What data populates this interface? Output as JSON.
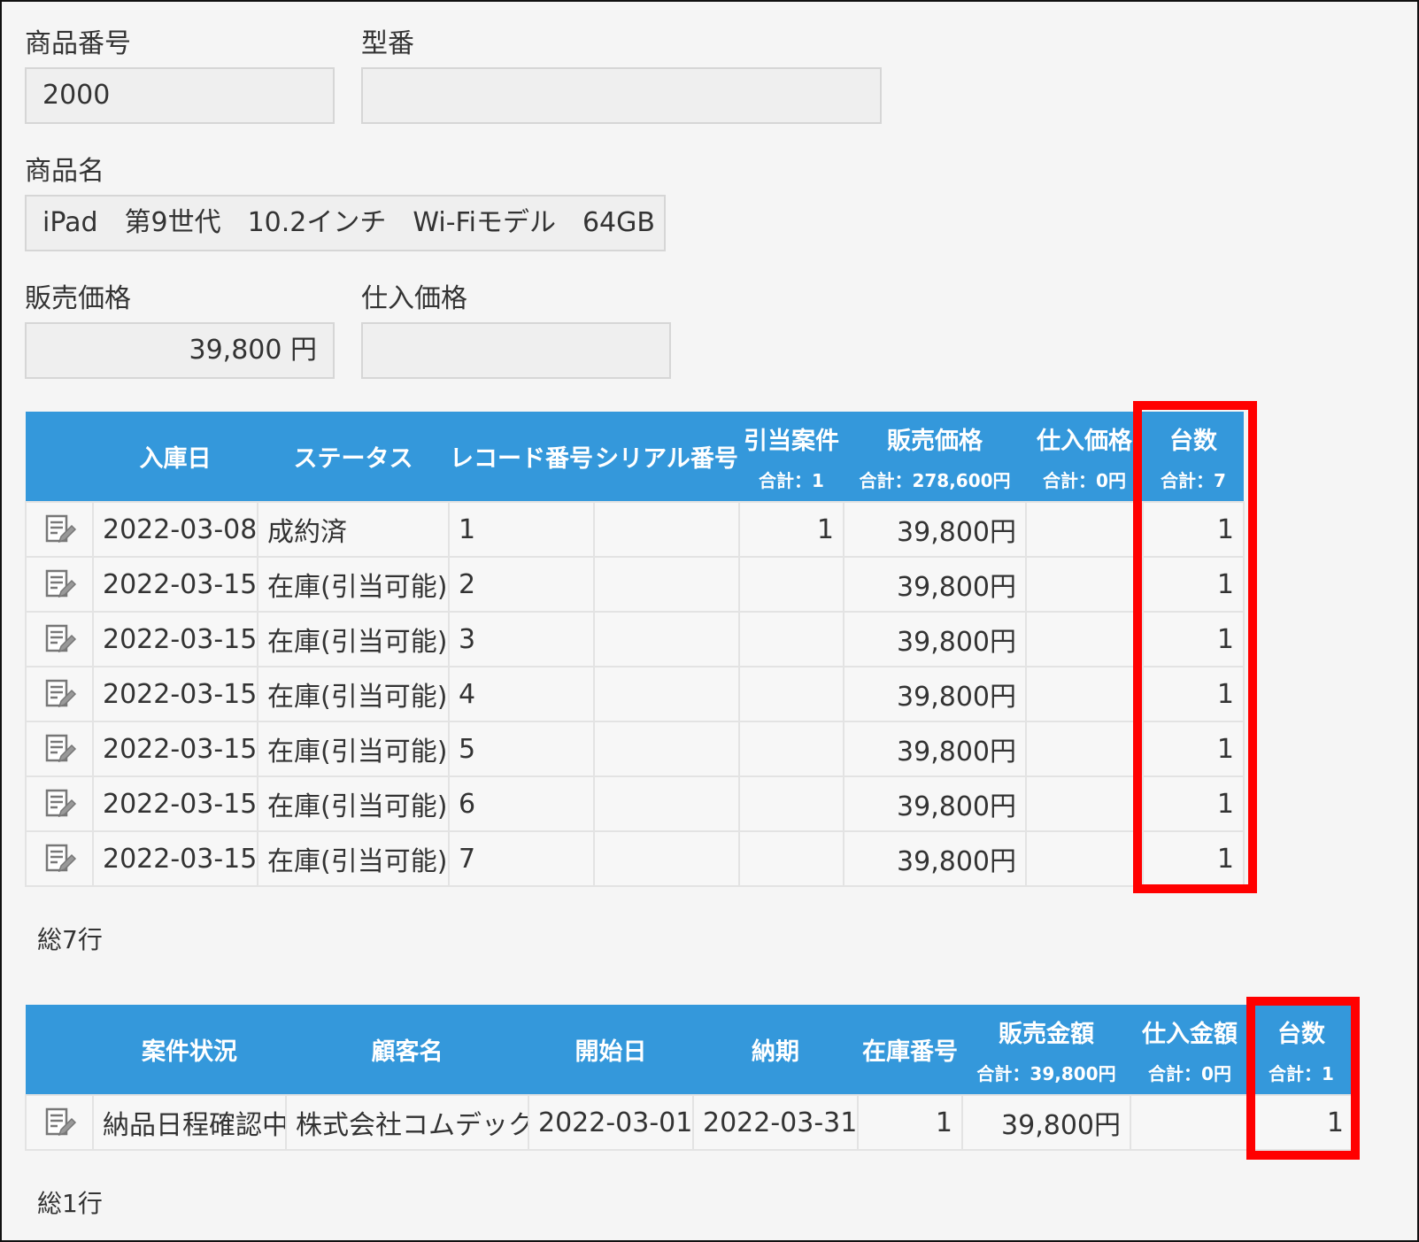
{
  "form": {
    "product_number_label": "商品番号",
    "product_number_value": "2000",
    "model_label": "型番",
    "model_value": "",
    "product_name_label": "商品名",
    "product_name_value": "iPad　第9世代　10.2インチ　Wi-Fiモデル　64GB",
    "sale_price_label": "販売価格",
    "sale_price_value": "39,800 円",
    "purchase_price_label": "仕入価格",
    "purchase_price_value": ""
  },
  "stock_table": {
    "headers": {
      "date": "入庫日",
      "status": "ステータス",
      "record_no": "レコード番号",
      "serial_no": "シリアル番号",
      "allocated": "引当案件",
      "allocated_total": "合計：1",
      "sale_price": "販売価格",
      "sale_price_total": "合計：278,600円",
      "purchase_price": "仕入価格",
      "purchase_price_total": "合計：0円",
      "units": "台数",
      "units_total": "合計：7"
    },
    "rows": [
      {
        "date": "2022-03-08",
        "status": "成約済",
        "record_no": "1",
        "serial_no": "",
        "allocated": "1",
        "sale_price": "39,800円",
        "purchase_price": "",
        "units": "1"
      },
      {
        "date": "2022-03-15",
        "status": "在庫(引当可能)",
        "record_no": "2",
        "serial_no": "",
        "allocated": "",
        "sale_price": "39,800円",
        "purchase_price": "",
        "units": "1"
      },
      {
        "date": "2022-03-15",
        "status": "在庫(引当可能)",
        "record_no": "3",
        "serial_no": "",
        "allocated": "",
        "sale_price": "39,800円",
        "purchase_price": "",
        "units": "1"
      },
      {
        "date": "2022-03-15",
        "status": "在庫(引当可能)",
        "record_no": "4",
        "serial_no": "",
        "allocated": "",
        "sale_price": "39,800円",
        "purchase_price": "",
        "units": "1"
      },
      {
        "date": "2022-03-15",
        "status": "在庫(引当可能)",
        "record_no": "5",
        "serial_no": "",
        "allocated": "",
        "sale_price": "39,800円",
        "purchase_price": "",
        "units": "1"
      },
      {
        "date": "2022-03-15",
        "status": "在庫(引当可能)",
        "record_no": "6",
        "serial_no": "",
        "allocated": "",
        "sale_price": "39,800円",
        "purchase_price": "",
        "units": "1"
      },
      {
        "date": "2022-03-15",
        "status": "在庫(引当可能)",
        "record_no": "7",
        "serial_no": "",
        "allocated": "",
        "sale_price": "39,800円",
        "purchase_price": "",
        "units": "1"
      }
    ],
    "row_count": "総7行"
  },
  "deal_table": {
    "headers": {
      "deal_status": "案件状況",
      "customer": "顧客名",
      "start_date": "開始日",
      "due_date": "納期",
      "stock_no": "在庫番号",
      "sale_amount": "販売金額",
      "sale_amount_total": "合計：39,800円",
      "purchase_amount": "仕入金額",
      "purchase_amount_total": "合計：0円",
      "units": "台数",
      "units_total": "合計：1"
    },
    "rows": [
      {
        "deal_status": "納品日程確認中",
        "customer": "株式会社コムデック",
        "start_date": "2022-03-01",
        "due_date": "2022-03-31",
        "stock_no": "1",
        "sale_amount": "39,800円",
        "purchase_amount": "",
        "units": "1"
      }
    ],
    "row_count": "総1行"
  },
  "colors": {
    "header_blue": "#3498db",
    "highlight_red": "#ff0000"
  },
  "icons": {
    "row_edit": "edit-record-icon"
  }
}
